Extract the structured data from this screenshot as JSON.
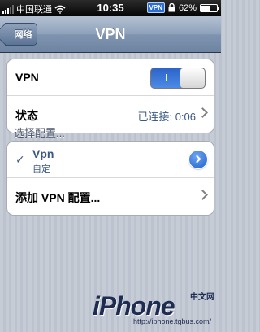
{
  "status_bar": {
    "carrier": "中国联通",
    "time": "10:35",
    "vpn_badge": "VPN",
    "battery_percent_label": "62%",
    "battery_level": 0.62
  },
  "nav": {
    "back_label": "网络",
    "title": "VPN"
  },
  "vpn_group": {
    "toggle_label": "VPN",
    "toggle_state_text": "I",
    "status_label": "状态",
    "status_value": "已连接: 0:06"
  },
  "config_section": {
    "header": "选择配置...",
    "selected": {
      "checkmark": "✓",
      "name": "Vpn",
      "subtitle": "自定"
    },
    "add_label": "添加 VPN 配置..."
  },
  "watermark": {
    "logo": "iPhone",
    "cn": "中文网",
    "url": "http://iphone.tgbus.com/"
  },
  "colors": {
    "accent": "#3b5886",
    "toggle_on": "#2c64c9"
  }
}
